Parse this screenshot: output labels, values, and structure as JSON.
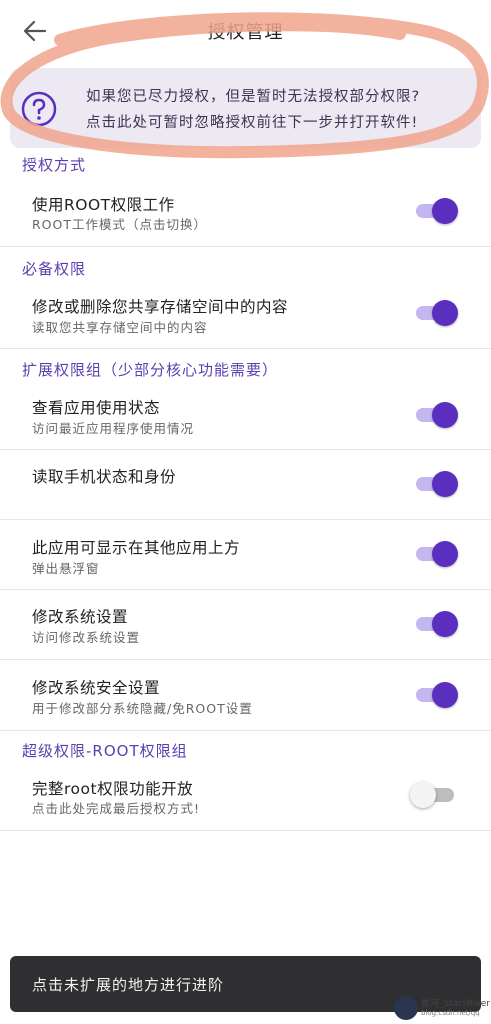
{
  "header": {
    "title": "授权管理",
    "back_icon": "arrow-left-icon"
  },
  "notice": {
    "icon": "question-circle-icon",
    "line1": "如果您已尽力授权，但是暂时无法授权部分权限?",
    "line2": "点击此处可暂时忽略授权前往下一步并打开软件!"
  },
  "sections": [
    {
      "header": "授权方式",
      "items": [
        {
          "title": "使用ROOT权限工作",
          "subtitle": "ROOT工作模式（点击切换）",
          "on": true
        }
      ]
    },
    {
      "header": "必备权限",
      "items": [
        {
          "title": "修改或删除您共享存储空间中的内容",
          "subtitle": "读取您共享存储空间中的内容",
          "on": true
        }
      ]
    },
    {
      "header": "扩展权限组（少部分核心功能需要）",
      "items": [
        {
          "title": "查看应用使用状态",
          "subtitle": "访问最近应用程序使用情况",
          "on": true
        },
        {
          "title": "读取手机状态和身份",
          "subtitle": "",
          "on": true
        },
        {
          "title": "此应用可显示在其他应用上方",
          "subtitle": "弹出悬浮窗",
          "on": true
        },
        {
          "title": "修改系统设置",
          "subtitle": "访问修改系统设置",
          "on": true
        },
        {
          "title": "修改系统安全设置",
          "subtitle": "用于修改部分系统隐藏/免ROOT设置",
          "on": true
        }
      ]
    },
    {
      "header": "超级权限-ROOT权限组",
      "items": [
        {
          "title": "完整root权限功能开放",
          "subtitle": "点击此处完成最后授权方式!",
          "on": false
        }
      ]
    }
  ],
  "toast": {
    "text": "点击未扩展的地方进行进阶"
  },
  "watermark": {
    "name": "星河_StarsRiver",
    "url": "blog.csdn.net/qq"
  },
  "colors": {
    "accent": "#5a2fc0",
    "accent_light": "#c4b6ee",
    "section_header": "#5b3fb0",
    "notice_bg": "#ece9f3",
    "annotation": "#f1a48c"
  }
}
